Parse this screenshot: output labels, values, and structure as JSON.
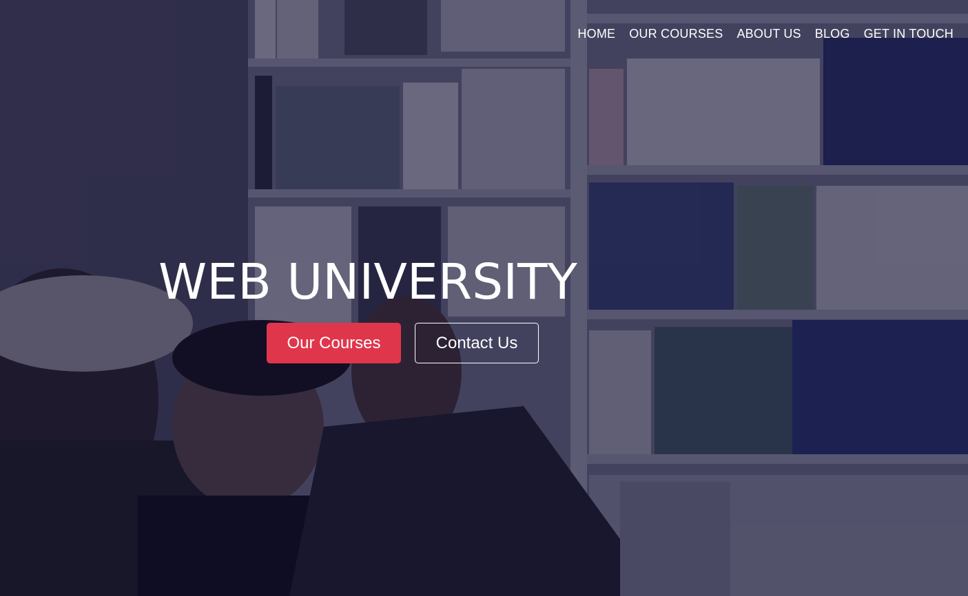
{
  "nav": {
    "items": [
      {
        "label": "HOME"
      },
      {
        "label": "OUR COURSES"
      },
      {
        "label": "ABOUT US"
      },
      {
        "label": "BLOG"
      },
      {
        "label": "GET IN TOUCH"
      }
    ]
  },
  "hero": {
    "title": "WEB UNIVERSITY",
    "primary_button": "Our Courses",
    "secondary_button": "Contact Us"
  },
  "colors": {
    "accent": "#e0364b",
    "overlay": "#0a0828",
    "text": "#ffffff"
  }
}
